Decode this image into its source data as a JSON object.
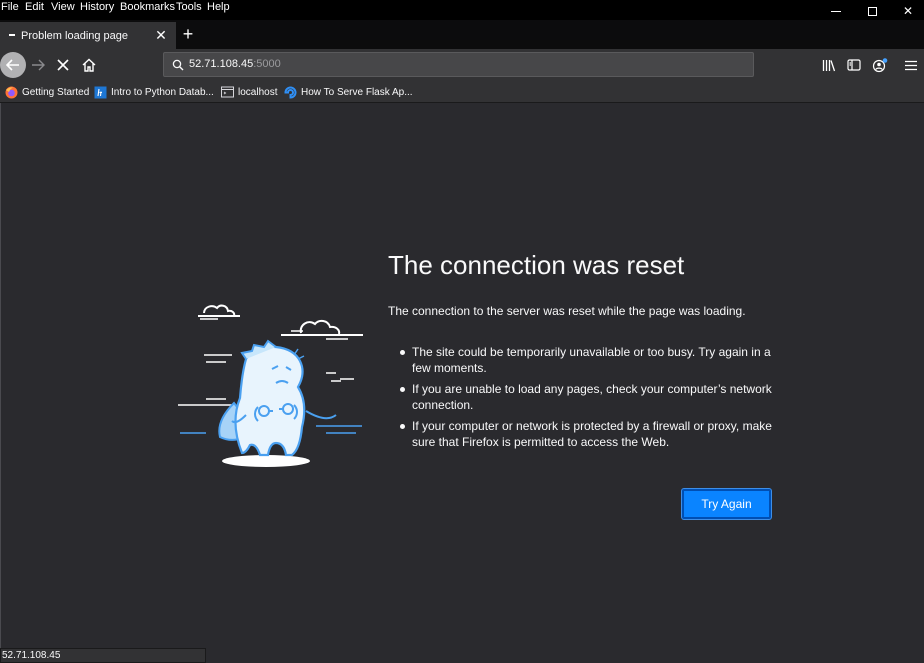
{
  "menu": [
    "File",
    "Edit",
    "View",
    "History",
    "Bookmarks",
    "Tools",
    "Help"
  ],
  "window_controls": {
    "minimize": "—",
    "maximize": "☐",
    "close": "✕"
  },
  "tab": {
    "title": "Problem loading page",
    "close": "✕",
    "new_tab": "+"
  },
  "urlbar": {
    "host": "52.71.108.45",
    "port": ":5000"
  },
  "bookmarks": [
    {
      "label": "Getting Started",
      "icon": "firefox-icon"
    },
    {
      "label": "Intro to Python Datab...",
      "icon": "blue-page-icon"
    },
    {
      "label": "localhost",
      "icon": "window-icon"
    },
    {
      "label": "How To Serve Flask Ap...",
      "icon": "digitalocean-icon"
    }
  ],
  "error": {
    "title": "The connection was reset",
    "description": "The connection to the server was reset while the page was loading.",
    "items": [
      "The site could be temporarily unavailable or too busy. Try again in a few moments.",
      "If you are unable to load any pages, check your computer’s network connection.",
      "If your computer or network is protected by a firewall or proxy, make sure that Firefox is permitted to access the Web."
    ],
    "button": "Try Again"
  },
  "status": "52.71.108.45",
  "colors": {
    "accent": "#0a84ff",
    "content_bg": "#2a2a2e",
    "toolbar_bg": "#323234"
  }
}
